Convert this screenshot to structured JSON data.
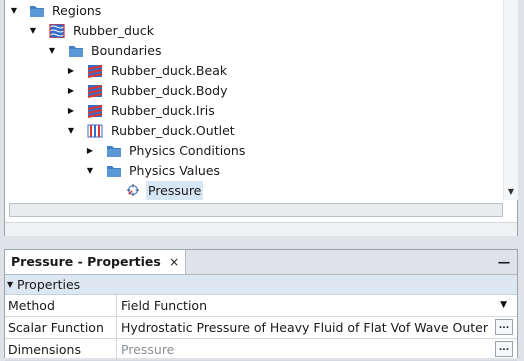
{
  "tree": {
    "nodes": [
      {
        "label": "Regions",
        "icon": "folder-icon",
        "expanded": true
      },
      {
        "label": "Rubber_duck",
        "icon": "region-icon",
        "expanded": true
      },
      {
        "label": "Boundaries",
        "icon": "folder-icon",
        "expanded": true
      },
      {
        "label": "Rubber_duck.Beak",
        "icon": "wall-boundary-icon",
        "expanded": false
      },
      {
        "label": "Rubber_duck.Body",
        "icon": "wall-boundary-icon",
        "expanded": false
      },
      {
        "label": "Rubber_duck.Iris",
        "icon": "wall-boundary-icon",
        "expanded": false
      },
      {
        "label": "Rubber_duck.Outlet",
        "icon": "outlet-boundary-icon",
        "expanded": true
      },
      {
        "label": "Physics Conditions",
        "icon": "folder-icon",
        "expanded": false
      },
      {
        "label": "Physics Values",
        "icon": "folder-icon",
        "expanded": true
      },
      {
        "label": "Pressure",
        "icon": "pressure-value-icon",
        "selected": true
      }
    ]
  },
  "properties": {
    "tab_title": "Pressure - Properties",
    "close_glyph": "×",
    "minimize_glyph": "—",
    "section_title": "Properties",
    "rows": [
      {
        "name": "Method",
        "value": "Field Function",
        "control": "dropdown"
      },
      {
        "name": "Scalar Function",
        "value": "Hydrostatic Pressure of Heavy Fluid of Flat Vof Wave Outer",
        "control": "ellipsis"
      },
      {
        "name": "Dimensions",
        "value": "Pressure",
        "control": "ellipsis"
      }
    ],
    "ellipsis_glyph": "..."
  },
  "colors": {
    "folder": "#3f7fc4",
    "region": "#2f6fd0",
    "wall_stripe": "#e0342c",
    "outlet_stripe": "#e0342c",
    "selection": "#d6e6f5"
  }
}
